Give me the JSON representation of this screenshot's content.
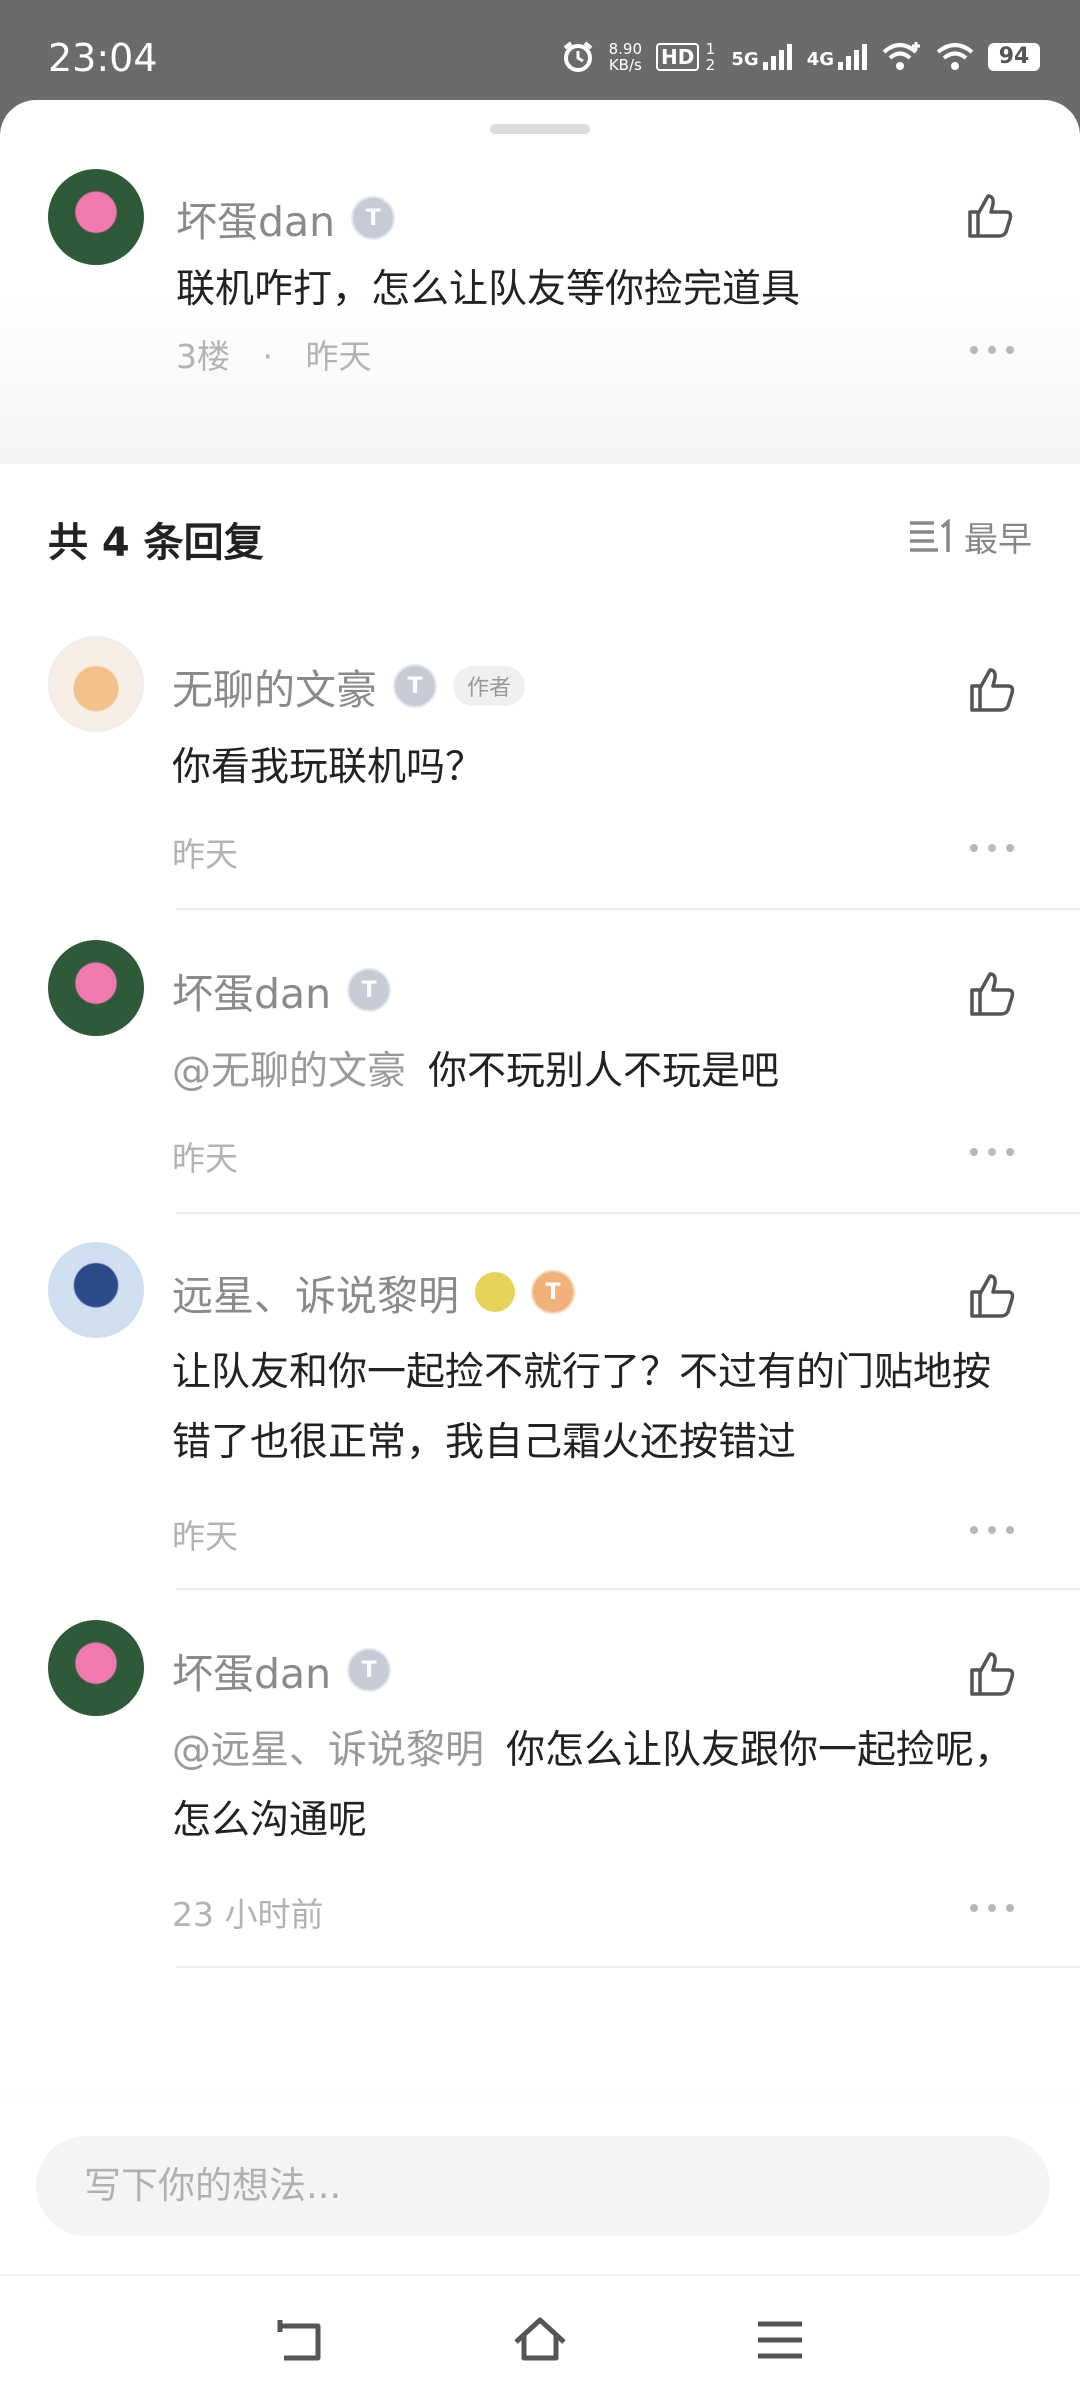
{
  "status_bar": {
    "time": "23:04",
    "net_speed_value": "8.90",
    "net_speed_unit": "KB/s",
    "hd_label": "HD",
    "hd_sub": "1 2",
    "sig1_label": "5G",
    "sig2_label": "4G",
    "battery": "94"
  },
  "main_comment": {
    "username": "坏蛋dan",
    "level": "T",
    "text": "联机咋打，怎么让队友等你捡完道具",
    "floor": "3楼",
    "dot": "·",
    "time": "昨天"
  },
  "replies_header": {
    "count_label": "共 4 条回复",
    "sort_label": "最早"
  },
  "replies": [
    {
      "username": "无聊的文豪",
      "level": "T",
      "author_tag": "作者",
      "mention": "",
      "text": "你看我玩联机吗？",
      "time": "昨天"
    },
    {
      "username": "坏蛋dan",
      "level": "T",
      "mention": "@无聊的文豪",
      "text": "你不玩别人不玩是吧",
      "time": "昨天"
    },
    {
      "username": "远星、诉说黎明",
      "level": "T",
      "mention": "",
      "text": "让队友和你一起捡不就行了？不过有的门贴地按错了也很正常，我自己霜火还按错过",
      "time": "昨天"
    },
    {
      "username": "坏蛋dan",
      "level": "T",
      "mention": "@远星、诉说黎明",
      "text": "你怎么让队友跟你一起捡呢，怎么沟通呢",
      "time": "23 小时前"
    }
  ],
  "input": {
    "placeholder": "写下你的想法..."
  },
  "icons": {
    "like": "thumbs-up-icon",
    "more": "more-horizontal-icon",
    "sort": "sort-list-icon",
    "back": "back-icon",
    "home": "home-icon",
    "menu": "menu-icon"
  },
  "colors": {
    "status_bar_bg": "#6b6b6b",
    "primary_text": "#222222",
    "secondary_text": "#8a8a8a",
    "input_bg": "#f3f4f6"
  }
}
